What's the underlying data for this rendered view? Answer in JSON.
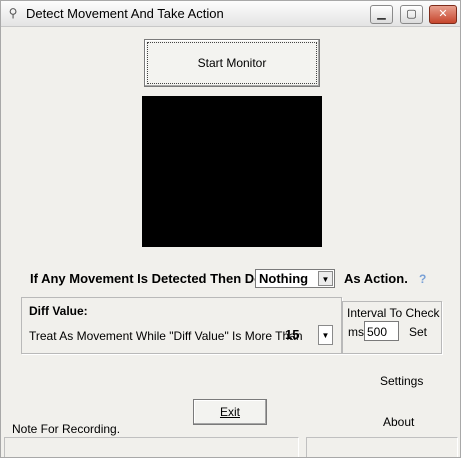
{
  "window": {
    "title": "Detect Movement And Take Action",
    "minimize_glyph": "▁",
    "maximize_glyph": "▢",
    "close_glyph": "✕",
    "app_icon_glyph": "⚲"
  },
  "monitor": {
    "start_label": "Start Monitor"
  },
  "action_row": {
    "prefix": "If Any Movement Is Detected Then Do",
    "selected_action": "Nothing",
    "suffix": "As Action.",
    "help": "?"
  },
  "diff": {
    "group_label": "Diff Value:",
    "description": "Treat As Movement While \"Diff Value\" Is More Than",
    "selected_value": "15"
  },
  "interval": {
    "group_label": "Interval To Check",
    "unit": "ms",
    "value": "500",
    "set_label": "Set"
  },
  "links": {
    "settings": "Settings",
    "about": "About"
  },
  "exit_label": "Exit",
  "note": "Note For Recording.",
  "icons": {
    "dropdown": "▼"
  }
}
